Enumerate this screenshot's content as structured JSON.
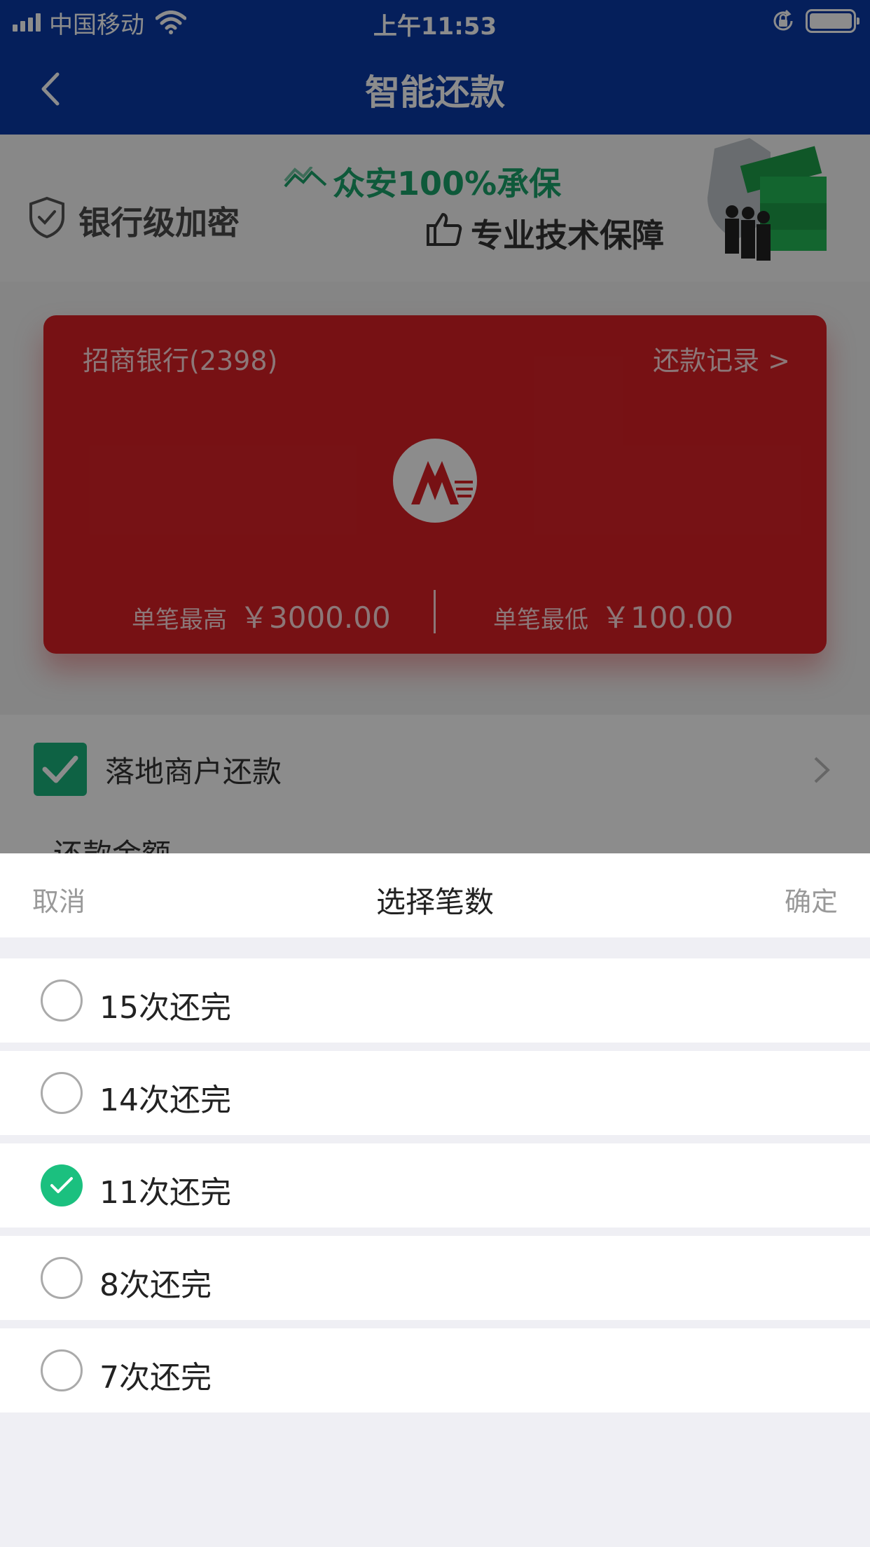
{
  "status_bar": {
    "carrier": "中国移动",
    "time": "上午11:53"
  },
  "nav": {
    "title": "智能还款"
  },
  "banner": {
    "security_text": "银行级加密",
    "insurance_text": "众安100%承保",
    "tech_text": "专业技术保障"
  },
  "card": {
    "bank_name": "招商银行(2398)",
    "record_link": "还款记录 >",
    "max_label": "单笔最高",
    "max_amount": "￥3000.00",
    "min_label": "单笔最低",
    "min_amount": "￥100.00",
    "color": "#d92026"
  },
  "method": {
    "label": "落地商户还款",
    "checked": true
  },
  "amount": {
    "label": "还款金额"
  },
  "sheet": {
    "cancel_label": "取消",
    "title": "选择笔数",
    "confirm_label": "确定",
    "options": [
      {
        "label": "15次还完",
        "selected": false
      },
      {
        "label": "14次还完",
        "selected": false
      },
      {
        "label": "11次还完",
        "selected": true
      },
      {
        "label": "8次还完",
        "selected": false
      },
      {
        "label": "7次还完",
        "selected": false
      }
    ]
  },
  "colors": {
    "nav": "#0a3aa6",
    "accent_green": "#1bc07f"
  }
}
